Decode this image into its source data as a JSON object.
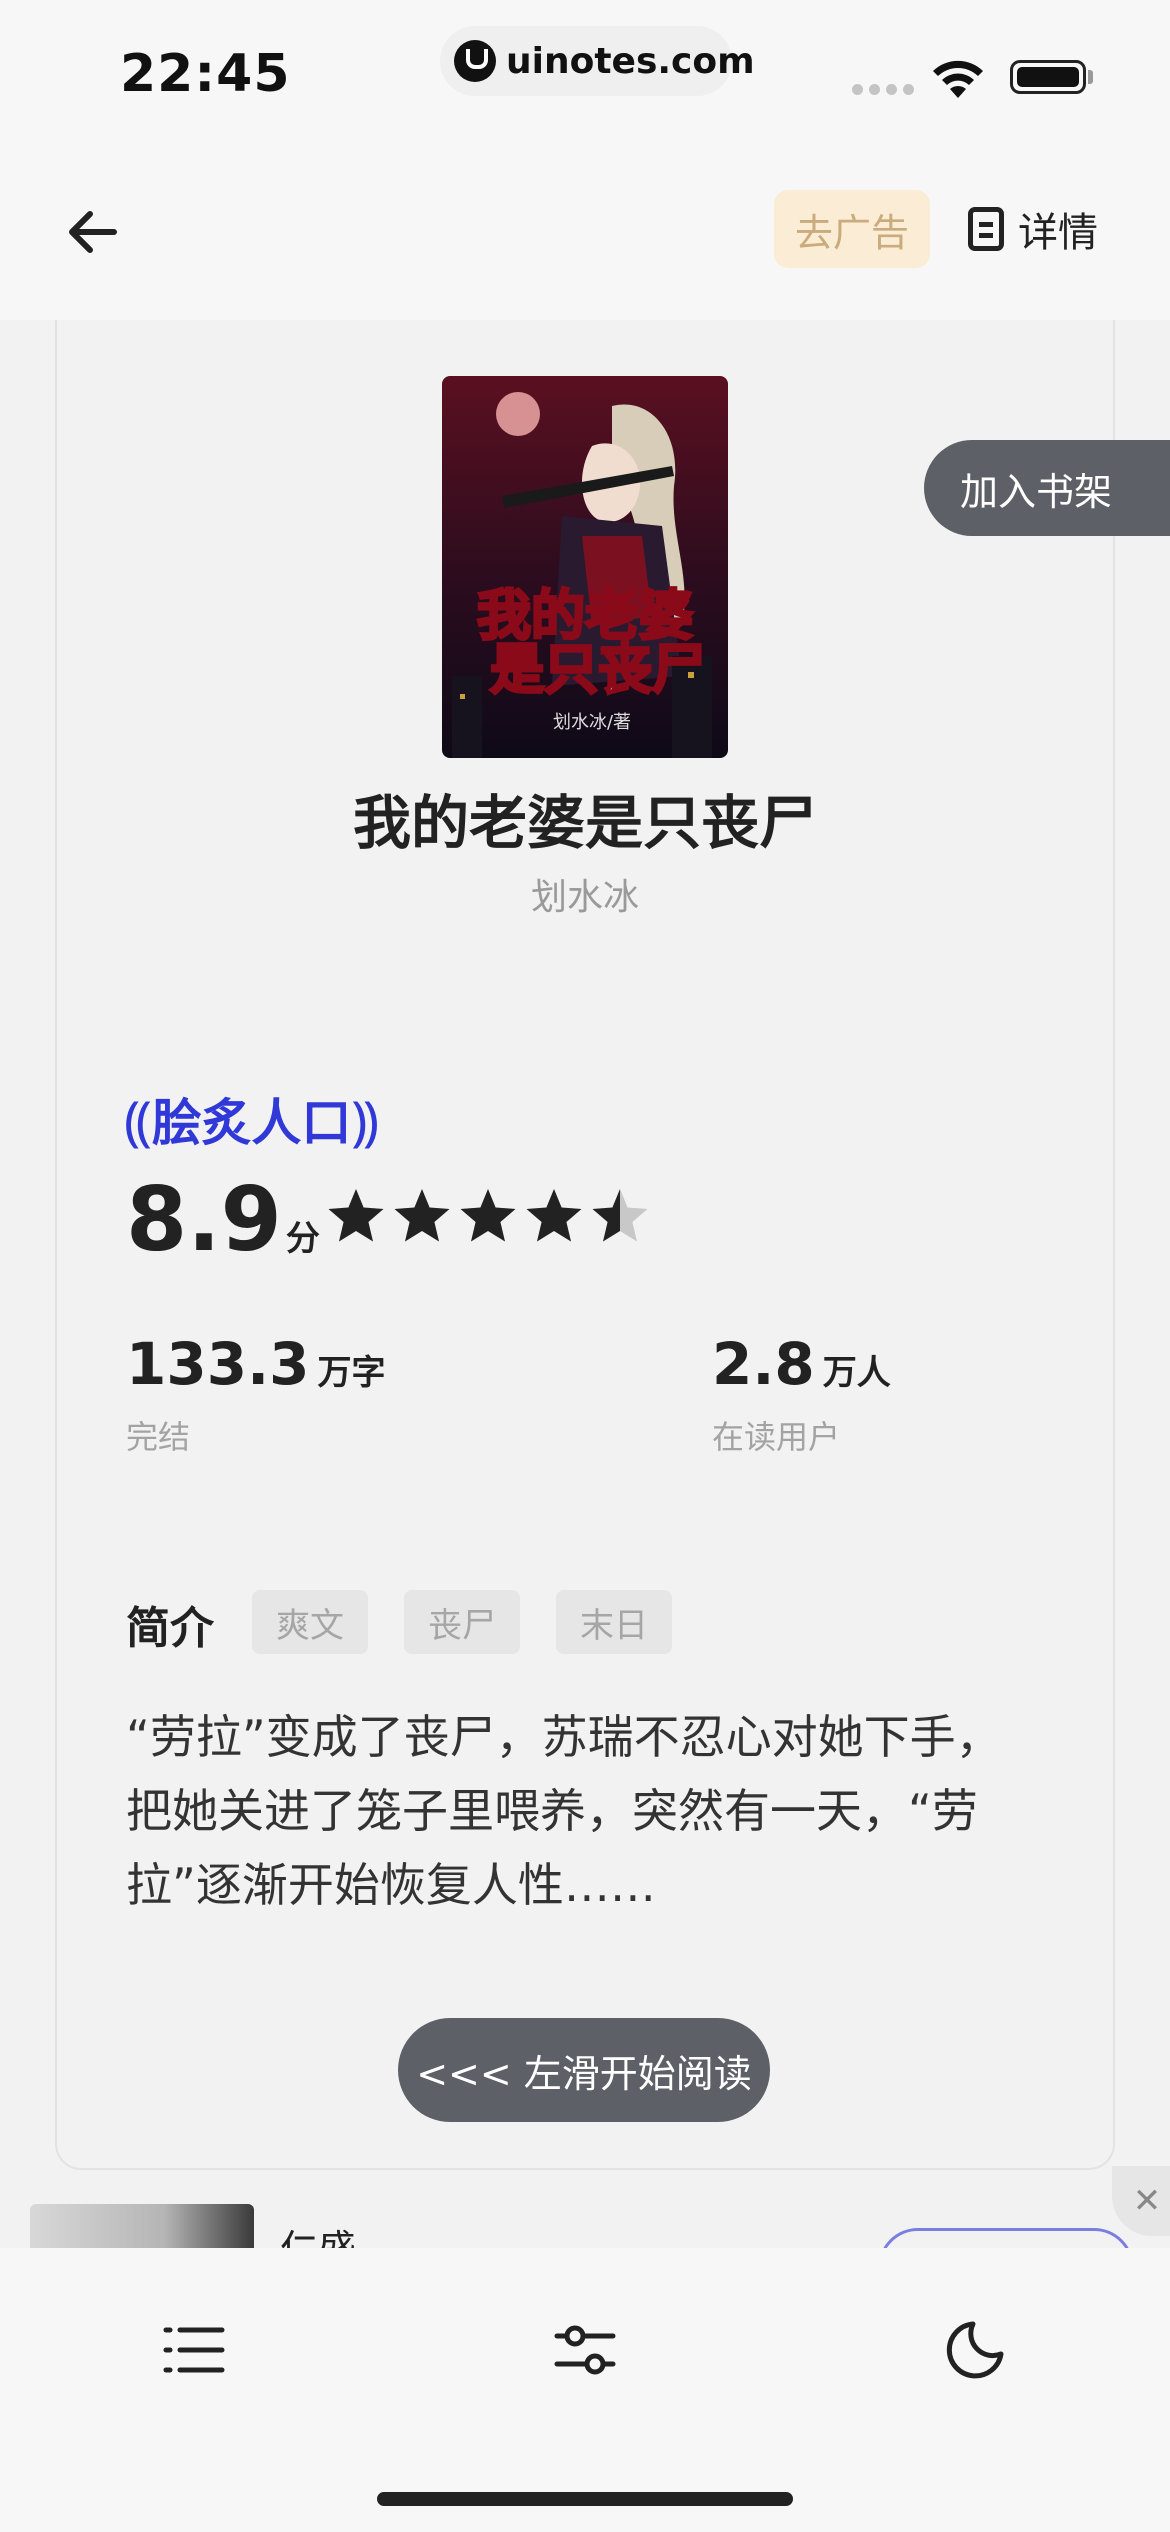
{
  "status_bar": {
    "time": "22:45",
    "url": "uinotes.com",
    "icons": [
      "signal-icon",
      "wifi-icon",
      "battery-icon"
    ]
  },
  "nav": {
    "back_icon": "arrow-left-icon",
    "remove_ads_label": "去广告",
    "details_label": "详情",
    "details_icon": "document-icon"
  },
  "book": {
    "cover_alt": "我的老婆是只丧尸",
    "cover_text_lines": [
      "我的老婆",
      "是只丧尸"
    ],
    "cover_author": "划水冰/著",
    "title": "我的老婆是只丧尸",
    "author": "划水冰",
    "add_to_shelf_label": "加入书架",
    "badge": "脍炙人口",
    "score": "8.9",
    "score_unit": "分",
    "star_rating": 4.5,
    "stats": [
      {
        "value": "133.3",
        "unit": "万字",
        "label": "完结"
      },
      {
        "value": "2.8",
        "unit": "万人",
        "label": "在读用户"
      }
    ],
    "intro_heading": "简介",
    "tags": [
      "爽文",
      "丧尸",
      "末日"
    ],
    "intro_text": "“劳拉”变成了丧尸，苏瑞不忍心对她下手，把她关进了笼子里喂养，突然有一天，“劳拉”逐渐开始恢复人性……",
    "read_button_label": "<<< 左滑开始阅读"
  },
  "ad": {
    "name": "仁盛",
    "close_label": "✕"
  },
  "toolbar": {
    "items": [
      "list-icon",
      "sliders-icon",
      "moon-icon"
    ]
  },
  "colors": {
    "accent_blue": "#3038d8",
    "ad_button_bg": "#fbecd6",
    "dark_button": "#5d6066"
  }
}
